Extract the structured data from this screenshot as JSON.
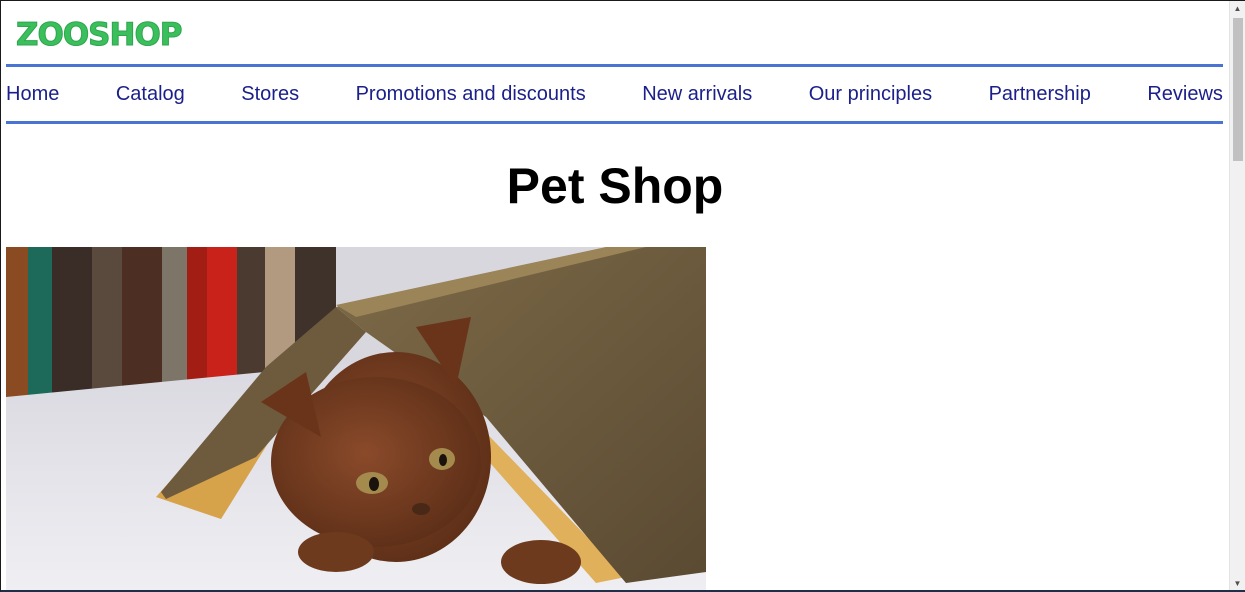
{
  "brand": {
    "logo_text": "ZOOSHOP",
    "logo_color": "#3bbf5c"
  },
  "nav": {
    "accent_color": "#4a74d4",
    "link_color": "#1b1f8a",
    "items": [
      {
        "label": "Home"
      },
      {
        "label": "Catalog"
      },
      {
        "label": "Stores"
      },
      {
        "label": "Promotions and discounts"
      },
      {
        "label": "New arrivals"
      },
      {
        "label": "Our principles"
      },
      {
        "label": "Partnership"
      },
      {
        "label": "Reviews"
      }
    ]
  },
  "main": {
    "title": "Pet Shop",
    "hero_image": {
      "icon": "kitten-under-book-image"
    }
  },
  "scrollbar": {
    "up_icon": "▲",
    "down_icon": "▼"
  }
}
